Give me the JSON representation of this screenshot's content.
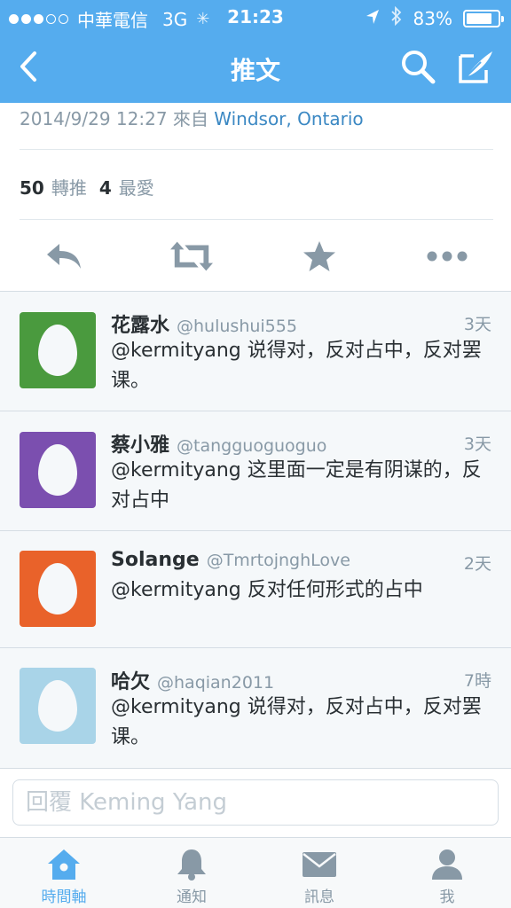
{
  "status_bar": {
    "carrier": "中華電信",
    "network": "3G",
    "time": "21:23",
    "battery_percent": "83%",
    "battery_level": 0.83,
    "signal_bars": 3
  },
  "nav": {
    "title": "推文",
    "back_icon": "chevron-left-icon",
    "search_icon": "search-icon",
    "compose_icon": "compose-icon"
  },
  "tweet": {
    "timestamp": "2014/9/29 12:27 來自",
    "location": "Windsor, Ontario",
    "retweet_count": "50",
    "retweet_label": "轉推",
    "favorite_count": "4",
    "favorite_label": "最愛"
  },
  "actions": [
    "reply-icon",
    "retweet-icon",
    "star-icon",
    "more-icon"
  ],
  "replies": [
    {
      "name": "花露水",
      "handle": "@hulushui555",
      "time": "3天",
      "text": "@kermityang 说得对，反对占中，反对罢课。",
      "avatar_color": "#4A9A3E"
    },
    {
      "name": "蔡小雅",
      "handle": "@tangguoguoguo",
      "time": "3天",
      "text": "@kermityang 这里面一定是有阴谋的，反对占中",
      "avatar_color": "#7B4FAF"
    },
    {
      "name": "Solange",
      "handle": "@TmrtojnghLove",
      "time": "2天",
      "text": "@kermityang 反对任何形式的占中",
      "avatar_color": "#E9622A"
    },
    {
      "name": "哈欠",
      "handle": "@haqian2011",
      "time": "7時",
      "text": "@kermityang 说得对，反对占中，反对罢课。",
      "avatar_color": "#A9D4E8"
    }
  ],
  "reply_box": {
    "placeholder": "回覆 Keming Yang",
    "value": ""
  },
  "tabs": [
    {
      "label": "時間軸",
      "icon": "home-icon",
      "active": true
    },
    {
      "label": "通知",
      "icon": "bell-icon",
      "active": false
    },
    {
      "label": "訊息",
      "icon": "envelope-icon",
      "active": false
    },
    {
      "label": "我",
      "icon": "person-icon",
      "active": false
    }
  ],
  "colors": {
    "brand_blue": "#55ACEE",
    "link_blue": "#3B88C3",
    "icon_gray": "#8899A6"
  }
}
